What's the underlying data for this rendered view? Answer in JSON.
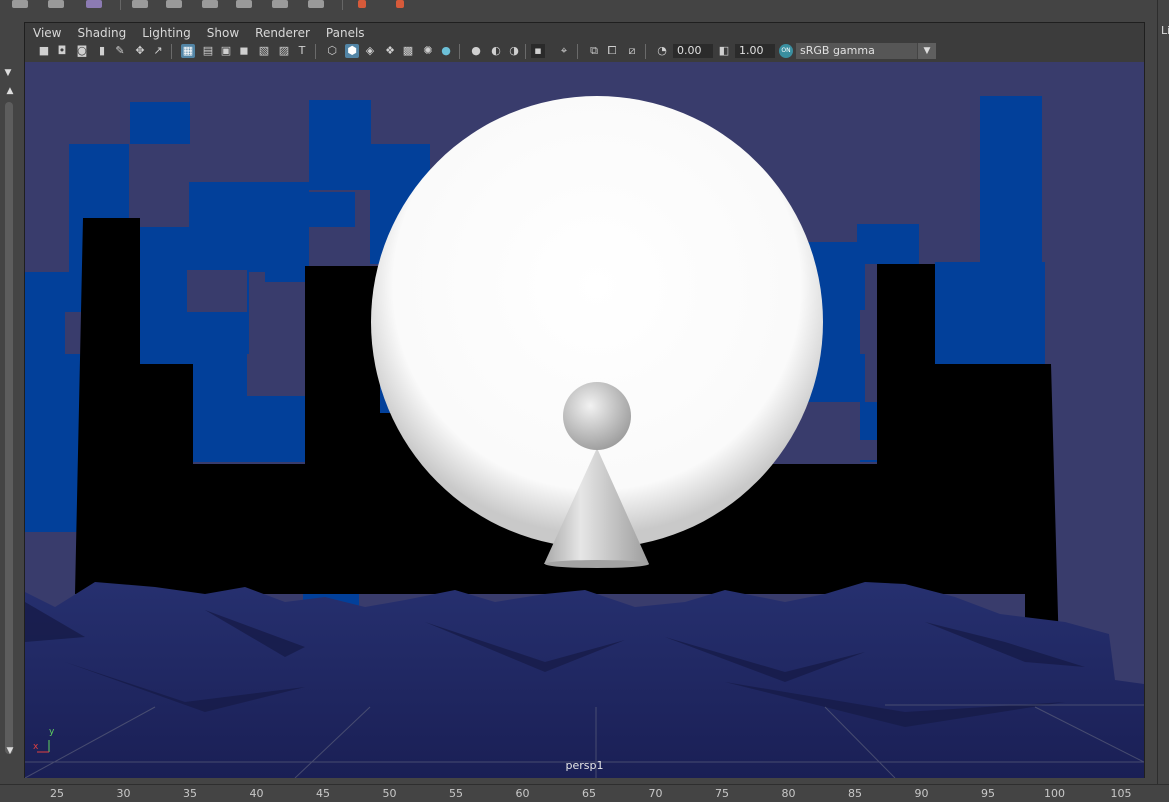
{
  "menu": [
    "View",
    "Shading",
    "Lighting",
    "Show",
    "Renderer",
    "Panels"
  ],
  "toolbar": {
    "exposure_value": "0.00",
    "gamma_value": "1.00",
    "color_mgmt_badge": "ON",
    "color_space": "sRGB gamma"
  },
  "viewport": {
    "camera_name": "persp1",
    "axis_y": "y",
    "axis_x": "x"
  },
  "timeline": {
    "ticks": [
      "25",
      "30",
      "35",
      "40",
      "45",
      "50",
      "55",
      "60",
      "65",
      "70",
      "75",
      "80",
      "85",
      "90",
      "95",
      "100",
      "105"
    ]
  },
  "right_panel": {
    "label": "Li"
  },
  "colors": {
    "sky": "#393c6c",
    "block_blue": "#02409a",
    "building": "#000000",
    "ground": "#1f2562",
    "moon": "#ffffff",
    "active_icon": "#5285a6"
  },
  "icons": [
    "camera-icon",
    "camera-lock-icon",
    "camera-attr-icon",
    "bookmark-icon",
    "pencil-icon",
    "move-icon",
    "select-icon",
    "grid-icon",
    "film-gate-icon",
    "resolution-gate-icon",
    "gate-mask-icon",
    "field-chart-icon",
    "safe-action-icon",
    "safe-title-icon",
    "wireframe-icon",
    "smooth-shade-icon",
    "wireframe-on-shaded-icon",
    "textured-icon",
    "checker-icon",
    "lights-icon",
    "shadows-icon",
    "ambient-occlusion-icon",
    "motion-blur-icon",
    "antialias-icon",
    "isolate-icon",
    "xray-icon",
    "xray-joints-icon",
    "xray-components-icon",
    "exposure-icon",
    "gamma-icon"
  ]
}
